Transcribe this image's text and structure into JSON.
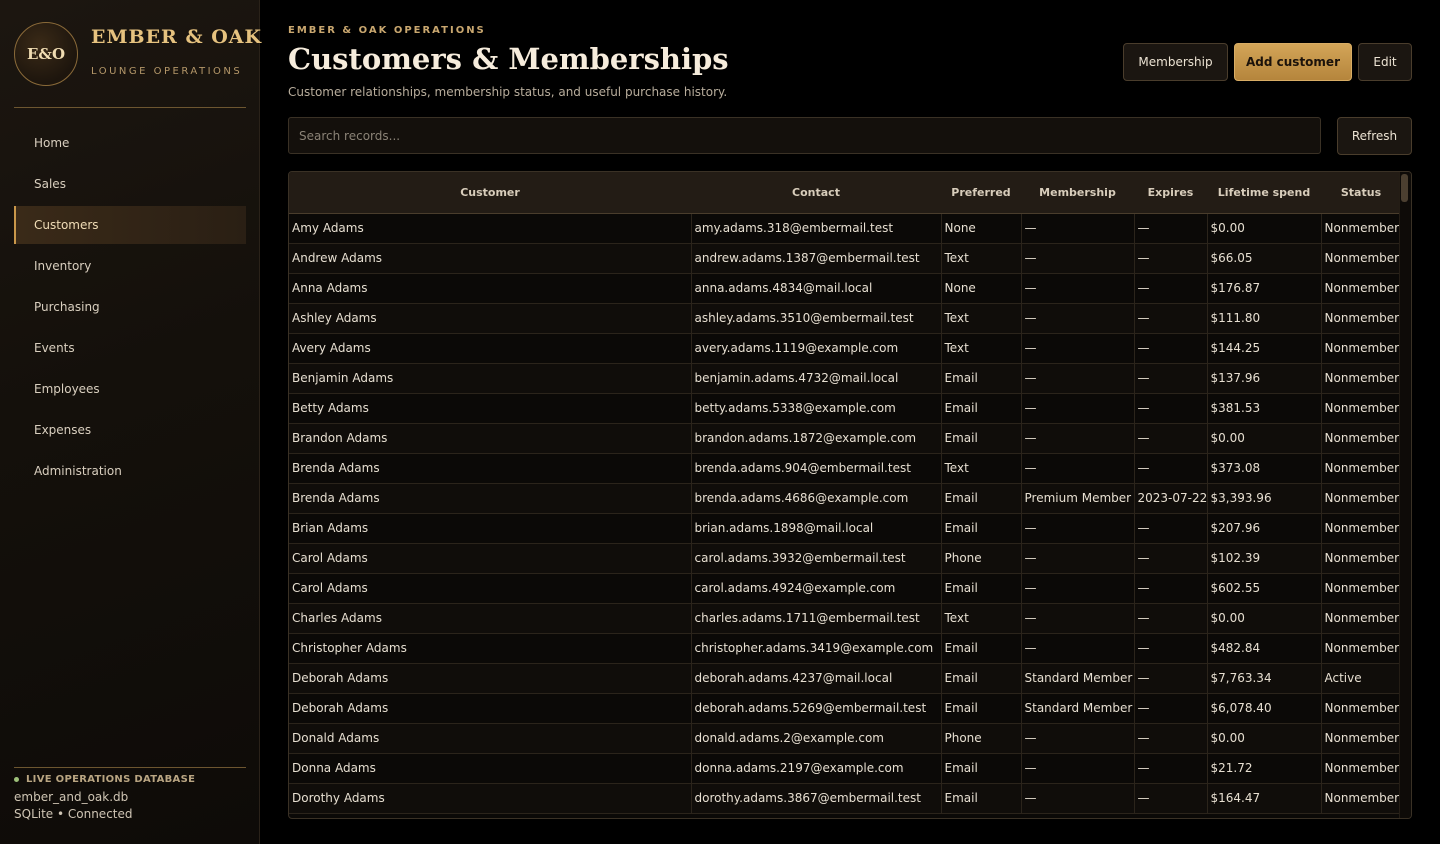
{
  "brand": {
    "logo": "E&O",
    "name": "EMBER & OAK",
    "tagline": "LOUNGE OPERATIONS"
  },
  "nav": {
    "items": [
      {
        "label": "Home"
      },
      {
        "label": "Sales"
      },
      {
        "label": "Customers",
        "active": true
      },
      {
        "label": "Inventory"
      },
      {
        "label": "Purchasing"
      },
      {
        "label": "Events"
      },
      {
        "label": "Employees"
      },
      {
        "label": "Expenses"
      },
      {
        "label": "Administration"
      }
    ]
  },
  "db": {
    "status": "LIVE OPERATIONS DATABASE",
    "file": "ember_and_oak.db",
    "connection": "SQLite • Connected"
  },
  "header": {
    "eyebrow": "EMBER & OAK OPERATIONS",
    "title": "Customers & Memberships",
    "subtitle": "Customer relationships, membership status, and useful purchase history."
  },
  "toolbar": {
    "membership_label": "Membership",
    "add_label": "Add customer",
    "edit_label": "Edit",
    "refresh_label": "Refresh"
  },
  "search": {
    "placeholder": "Search records...",
    "value": ""
  },
  "table": {
    "columns": [
      "Customer",
      "Contact",
      "Preferred",
      "Membership",
      "Expires",
      "Lifetime spend",
      "Status"
    ],
    "rows": [
      [
        "Amy Adams",
        "amy.adams.318@embermail.test",
        "None",
        "—",
        "—",
        "$0.00",
        "Nonmember"
      ],
      [
        "Andrew Adams",
        "andrew.adams.1387@embermail.test",
        "Text",
        "—",
        "—",
        "$66.05",
        "Nonmember"
      ],
      [
        "Anna Adams",
        "anna.adams.4834@mail.local",
        "None",
        "—",
        "—",
        "$176.87",
        "Nonmember"
      ],
      [
        "Ashley Adams",
        "ashley.adams.3510@embermail.test",
        "Text",
        "—",
        "—",
        "$111.80",
        "Nonmember"
      ],
      [
        "Avery Adams",
        "avery.adams.1119@example.com",
        "Text",
        "—",
        "—",
        "$144.25",
        "Nonmember"
      ],
      [
        "Benjamin Adams",
        "benjamin.adams.4732@mail.local",
        "Email",
        "—",
        "—",
        "$137.96",
        "Nonmember"
      ],
      [
        "Betty Adams",
        "betty.adams.5338@example.com",
        "Email",
        "—",
        "—",
        "$381.53",
        "Nonmember"
      ],
      [
        "Brandon Adams",
        "brandon.adams.1872@example.com",
        "Email",
        "—",
        "—",
        "$0.00",
        "Nonmember"
      ],
      [
        "Brenda Adams",
        "brenda.adams.904@embermail.test",
        "Text",
        "—",
        "—",
        "$373.08",
        "Nonmember"
      ],
      [
        "Brenda Adams",
        "brenda.adams.4686@example.com",
        "Email",
        "Premium Member",
        "2023-07-22",
        "$3,393.96",
        "Nonmember"
      ],
      [
        "Brian Adams",
        "brian.adams.1898@mail.local",
        "Email",
        "—",
        "—",
        "$207.96",
        "Nonmember"
      ],
      [
        "Carol Adams",
        "carol.adams.3932@embermail.test",
        "Phone",
        "—",
        "—",
        "$102.39",
        "Nonmember"
      ],
      [
        "Carol Adams",
        "carol.adams.4924@example.com",
        "Email",
        "—",
        "—",
        "$602.55",
        "Nonmember"
      ],
      [
        "Charles Adams",
        "charles.adams.1711@embermail.test",
        "Text",
        "—",
        "—",
        "$0.00",
        "Nonmember"
      ],
      [
        "Christopher Adams",
        "christopher.adams.3419@example.com",
        "Email",
        "—",
        "—",
        "$482.84",
        "Nonmember"
      ],
      [
        "Deborah Adams",
        "deborah.adams.4237@mail.local",
        "Email",
        "Standard Member",
        "—",
        "$7,763.34",
        "Active"
      ],
      [
        "Deborah Adams",
        "deborah.adams.5269@embermail.test",
        "Email",
        "Standard Member",
        "—",
        "$6,078.40",
        "Nonmember"
      ],
      [
        "Donald Adams",
        "donald.adams.2@example.com",
        "Phone",
        "—",
        "—",
        "$0.00",
        "Nonmember"
      ],
      [
        "Donna Adams",
        "donna.adams.2197@example.com",
        "Email",
        "—",
        "—",
        "$21.72",
        "Nonmember"
      ],
      [
        "Dorothy Adams",
        "dorothy.adams.3867@embermail.test",
        "Email",
        "—",
        "—",
        "$164.47",
        "Nonmember"
      ]
    ]
  }
}
